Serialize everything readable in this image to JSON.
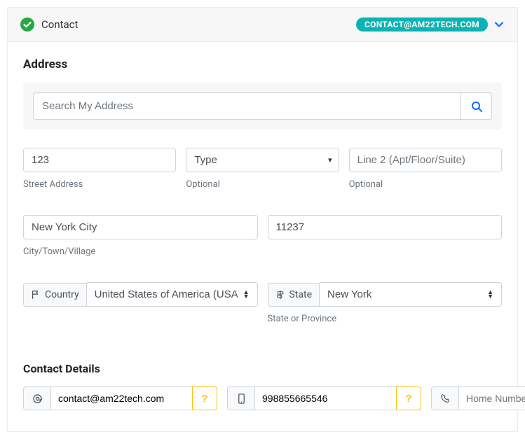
{
  "header": {
    "title": "Contact",
    "pill": "CONTACT@AM22TECH.COM"
  },
  "address": {
    "section_title": "Address",
    "search_placeholder": "Search My Address",
    "street": {
      "value": "123",
      "help": "Street Address"
    },
    "type": {
      "placeholder": "Type",
      "help": "Optional"
    },
    "line2": {
      "placeholder": "Line 2 (Apt/Floor/Suite)",
      "help": "Optional"
    },
    "city": {
      "value": "New York City",
      "help": "City/Town/Village"
    },
    "zip": {
      "value": "11237"
    },
    "country": {
      "label": "Country",
      "value": "United States of America (USA)"
    },
    "state": {
      "label": "State",
      "value": "New York",
      "help": "State or Province"
    }
  },
  "contact": {
    "section_title": "Contact Details",
    "email": {
      "value": "contact@am22tech.com"
    },
    "mobile": {
      "value": "998855665546"
    },
    "home": {
      "placeholder": "Home Number"
    }
  }
}
